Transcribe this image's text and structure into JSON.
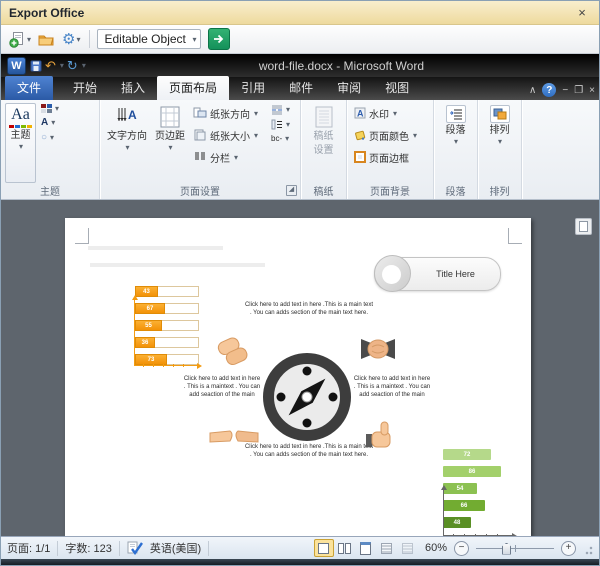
{
  "window": {
    "title": "Export Office"
  },
  "icons": {
    "dropdown": "▾",
    "close": "×",
    "collapse": "∧",
    "help": "?",
    "minimize": "−",
    "restore": "❐",
    "undo": "↶",
    "redo": "↻",
    "gear": "⚙",
    "w_logo": "W",
    "theme_aa": "Aa",
    "font_a": "A",
    "circle_o": "○",
    "hyphen_bc": "bc-",
    "launcher": "◢",
    "minus": "−",
    "plus": "+",
    "check": "✓"
  },
  "toolbar": {
    "combo_value": "Editable Object"
  },
  "word": {
    "title": "word-file.docx - Microsoft Word",
    "tabs": [
      {
        "label": "文件"
      },
      {
        "label": "开始"
      },
      {
        "label": "插入"
      },
      {
        "label": "页面布局"
      },
      {
        "label": "引用"
      },
      {
        "label": "邮件"
      },
      {
        "label": "审阅"
      },
      {
        "label": "视图"
      }
    ],
    "ribbon": {
      "themes": {
        "button": "主题",
        "group": "主题"
      },
      "page_setup": {
        "text_direction": "文字方向",
        "margins": "页边距",
        "orientation": "纸张方向",
        "size": "纸张大小",
        "columns": "分栏",
        "group": "页面设置"
      },
      "grid": {
        "line1": "稿纸",
        "line2": "设置",
        "group": "稿纸"
      },
      "background": {
        "watermark": "水印",
        "page_color": "页面颜色",
        "page_borders": "页面边框",
        "group": "页面背景"
      },
      "paragraph": {
        "button": "段落",
        "group": "段落"
      },
      "arrange": {
        "button": "排列",
        "group": "排列"
      }
    },
    "status": {
      "page": "页面: 1/1",
      "words": "字数: 123",
      "language": "英语(美国)",
      "zoom": "60%"
    }
  },
  "document": {
    "title_pill": "Title Here",
    "text_top": "Click here to add text in here .This is a main text . You can adds section of the main text here.",
    "text_left": "Click here to add text in here . This is a maintext . You can add seaction of the main",
    "text_right": "Click here to add text in here . This is a maintext . You can add seaction of the main",
    "text_bottom": "Click here to add text in here .This is a main text . You can adds section of the main text here.",
    "orange_chart": {
      "type": "bar",
      "orientation": "horizontal",
      "values": [
        43,
        67,
        55,
        36,
        73
      ],
      "color": "#F9A825"
    },
    "green_chart": {
      "type": "bar",
      "orientation": "horizontal",
      "values": [
        72,
        86,
        54,
        66,
        48
      ],
      "colors": [
        "#b5d98a",
        "#a3d06b",
        "#8cc152",
        "#72ac31",
        "#5a8f25"
      ]
    }
  }
}
